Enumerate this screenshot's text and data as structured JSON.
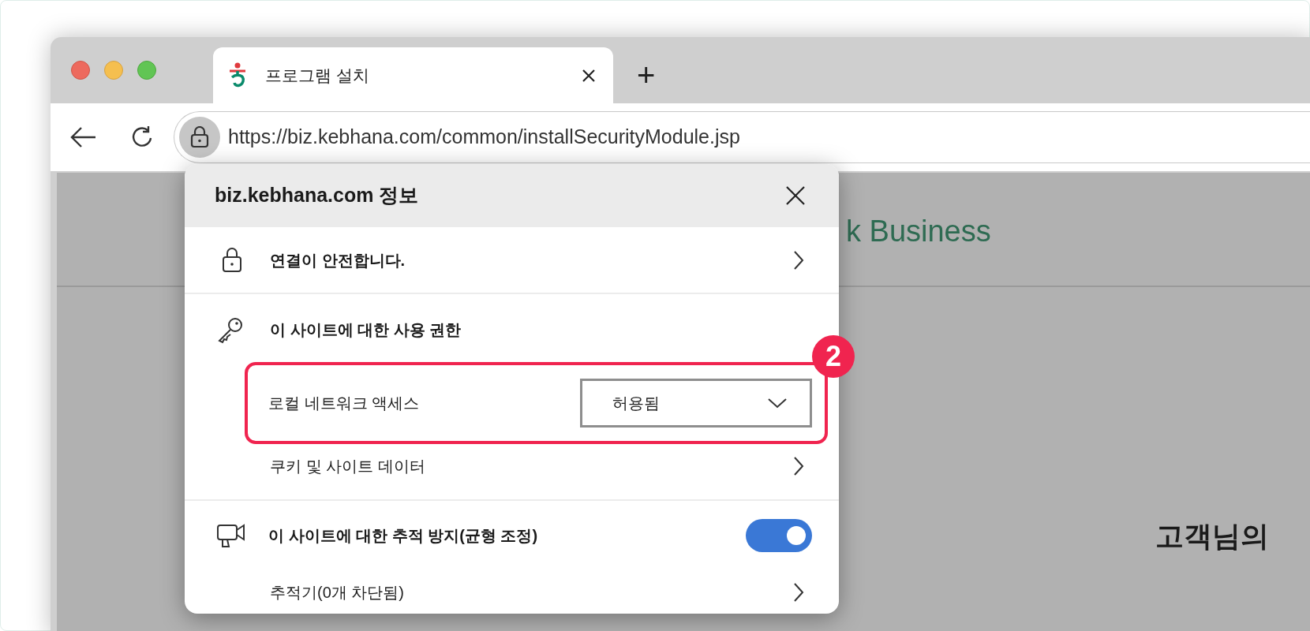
{
  "browser": {
    "tab": {
      "title": "프로그램 설치",
      "selected": true
    },
    "new_tab": "+",
    "url": "https://biz.kebhana.com/common/installSecurityModule.jsp"
  },
  "page": {
    "logo_text": "k Business",
    "heading": "고객님의"
  },
  "site_info": {
    "title": "biz.kebhana.com 정보",
    "connection": {
      "label": "연결이 안전합니다."
    },
    "permissions": {
      "label": "이 사이트에 대한 사용 권한",
      "items": [
        {
          "kind": "select",
          "label": "로컬 네트워크 액세스",
          "value": "허용됨",
          "highlighted": true,
          "badge": "2"
        },
        {
          "kind": "link",
          "label": "쿠키 및 사이트 데이터"
        }
      ]
    },
    "tracking": {
      "label": "이 사이트에 대한 추적 방지(균형 조정)",
      "on": true,
      "trackers": "추적기(0개 차단됨)"
    }
  }
}
